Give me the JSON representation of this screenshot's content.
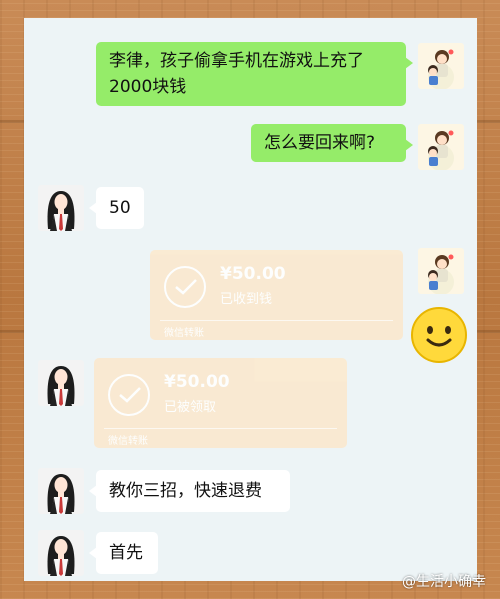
{
  "messages": [
    {
      "side": "right",
      "text": "李律，孩子偷拿手机在游戏上充了2000块钱"
    },
    {
      "side": "right",
      "text": "怎么要回来啊?"
    },
    {
      "side": "left",
      "text": "50"
    },
    {
      "side": "right",
      "type": "transfer",
      "amount": "¥50.00",
      "status": "已收到钱"
    },
    {
      "side": "left",
      "type": "transfer",
      "amount": "¥50.00",
      "status": "已被领取"
    },
    {
      "side": "left",
      "text": "教你三招，快速退费"
    },
    {
      "side": "left",
      "text": "首先"
    }
  ],
  "transfer_footer": "微信转账",
  "watermark": "@生活小确幸",
  "icons": {
    "user_avatar": "family-cartoon-avatar",
    "lawyer_avatar": "long-hair-woman-avatar",
    "transfer": "check-circle-icon",
    "emoji": "smiley-face-icon"
  },
  "colors": {
    "sent_bubble": "#95ec69",
    "received_bubble": "#ffffff",
    "transfer_card": "#fbe9cf",
    "chat_bg": "#edf4f6"
  }
}
